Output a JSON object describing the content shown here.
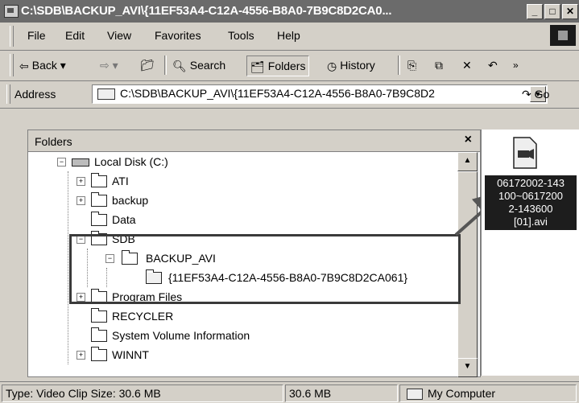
{
  "window": {
    "title": "C:\\SDB\\BACKUP_AVI\\{11EF53A4-C12A-4556-B8A0-7B9C8D2CA0..."
  },
  "menu": {
    "items": [
      "File",
      "Edit",
      "View",
      "Favorites",
      "Tools",
      "Help"
    ]
  },
  "toolbar": {
    "back": "Back",
    "search": "Search",
    "folders": "Folders",
    "history": "History"
  },
  "address": {
    "label": "Address",
    "value": "C:\\SDB\\BACKUP_AVI\\{11EF53A4-C12A-4556-B8A0-7B9C8D2",
    "go": "Go"
  },
  "folders_pane": {
    "title": "Folders",
    "tree": [
      {
        "label": "Local Disk (C:)",
        "kind": "drive",
        "expander": "−"
      },
      {
        "label": "ATI",
        "kind": "folder",
        "expander": "+"
      },
      {
        "label": "backup",
        "kind": "folder",
        "expander": "+"
      },
      {
        "label": "Data",
        "kind": "folder",
        "expander": ""
      },
      {
        "label": "SDB",
        "kind": "folder",
        "expander": "−"
      },
      {
        "label": "BACKUP_AVI",
        "kind": "folder",
        "expander": "−"
      },
      {
        "label": "{11EF53A4-C12A-4556-B8A0-7B9C8D2CA061}",
        "kind": "folder-open",
        "expander": ""
      },
      {
        "label": "Program Files",
        "kind": "folder",
        "expander": "+"
      },
      {
        "label": "RECYCLER",
        "kind": "folder",
        "expander": ""
      },
      {
        "label": "System Volume Information",
        "kind": "folder",
        "expander": ""
      },
      {
        "label": "WINNT",
        "kind": "folder",
        "expander": "+"
      }
    ]
  },
  "file": {
    "name": "06172002-143\n100~0617200\n2-143600\n[01].avi",
    "icon": "video-clip-icon"
  },
  "status": {
    "info": "Type: Video Clip Size: 30.6 MB",
    "size": "30.6 MB",
    "zone": "My Computer"
  }
}
